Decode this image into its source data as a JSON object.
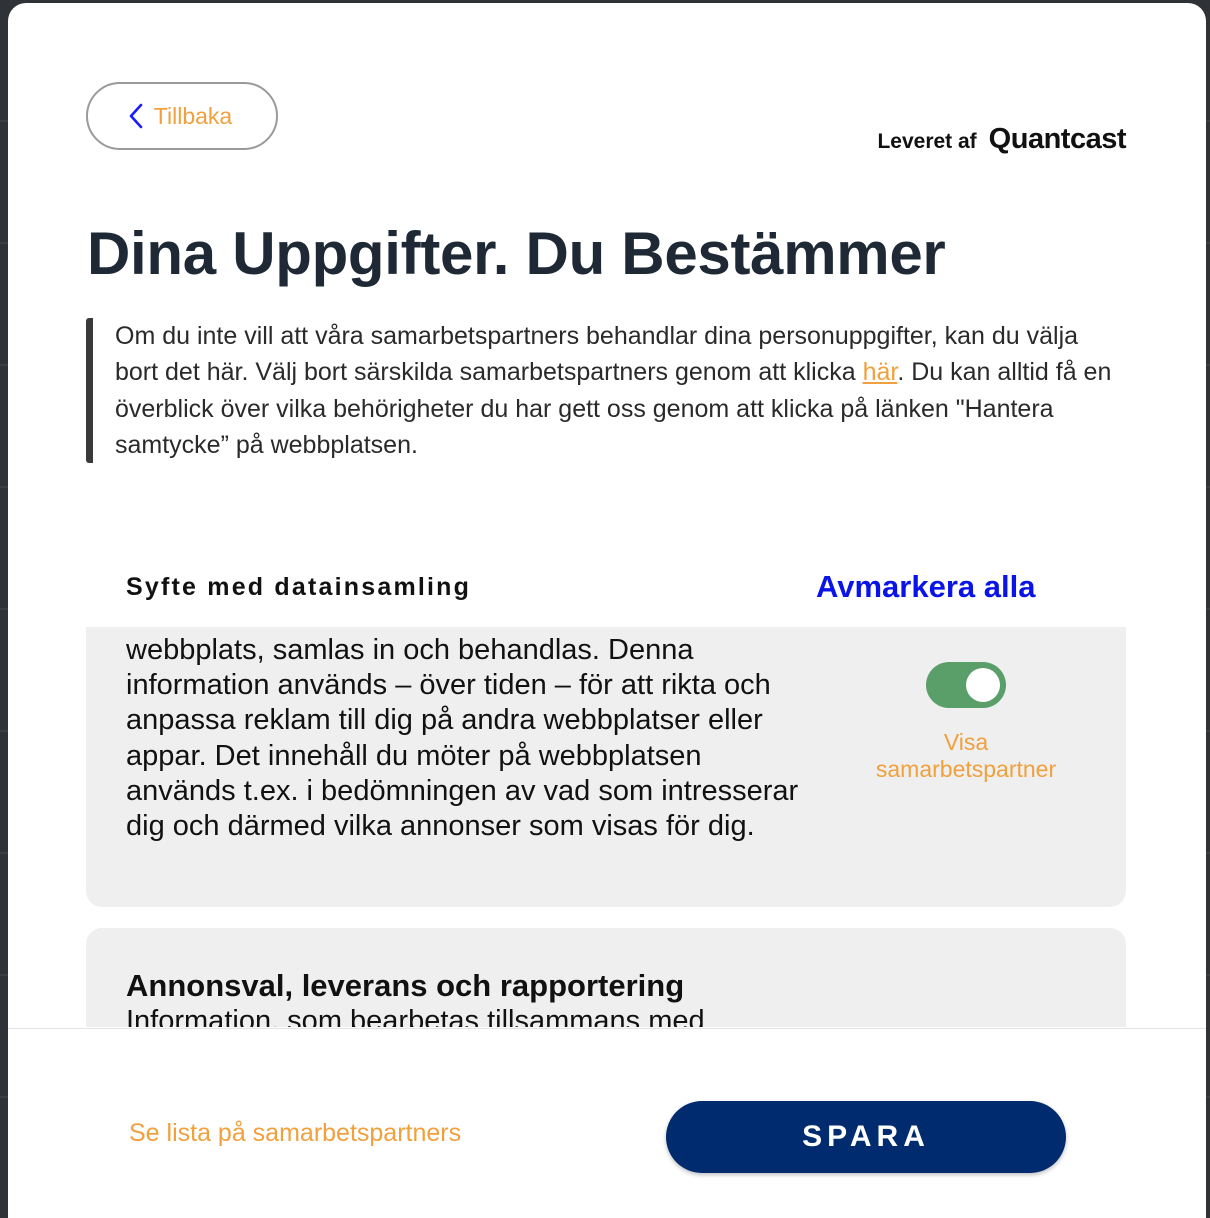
{
  "header": {
    "back_label": "Tillbaka",
    "powered_by": "Leveret af",
    "brand": "Quantcast"
  },
  "title": "Dina Uppgifter. Du Bestämmer",
  "intro": {
    "text_before": "Om du inte vill att våra samarbetspartners behandlar dina personuppgifter, kan du välja bort det här. Välj bort särskilda samarbetspartners genom att klicka ",
    "link": "här",
    "text_after": ". Du kan alltid få en överblick över vilka behörigheter du har gett oss genom att klicka på länken \"Hantera samtycke” på webbplatsen."
  },
  "purposes": {
    "header": "Syfte med datainsamling",
    "deselect_all": "Avmarkera alla",
    "items": [
      {
        "description": "webbplats, samlas in och behandlas. Denna information används – över tiden – för att rikta och anpassa reklam till dig på andra webbplatser eller appar. Det innehåll du möter på webbplatsen används t.ex. i bedömningen av vad som intresserar dig och därmed vilka annonser som visas för dig.",
        "toggle_on": true,
        "show_partners": "Visa samarbetspartner"
      },
      {
        "title": "Annonsval, leverans och rapportering",
        "description": "Information, som bearbetas tillsammans med"
      }
    ]
  },
  "footer": {
    "vendor_list": "Se lista på samarbetspartners",
    "save": "SPARA"
  },
  "colors": {
    "accent_orange": "#f0a03c",
    "link_blue": "#0a14e6",
    "save_navy": "#002b6e",
    "toggle_green": "#5a9e6a",
    "title_dark": "#1f2935"
  }
}
